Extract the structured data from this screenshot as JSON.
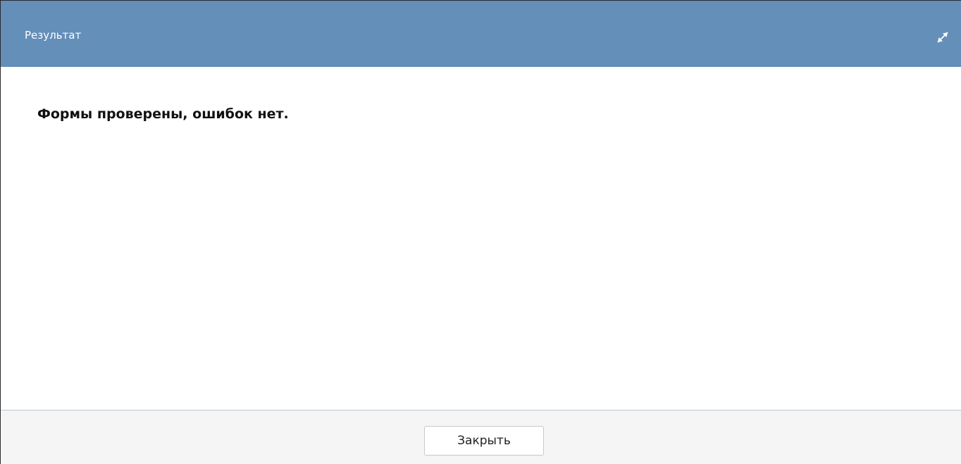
{
  "dialog": {
    "title": "Результат",
    "maximize_icon": "expand-diagonal-arrows",
    "message": "Формы проверены, ошибок нет.",
    "close_label": "Закрыть"
  },
  "colors": {
    "titlebar": "#648fb9",
    "title_text": "#ffffff",
    "footer": "#f5f5f5"
  }
}
